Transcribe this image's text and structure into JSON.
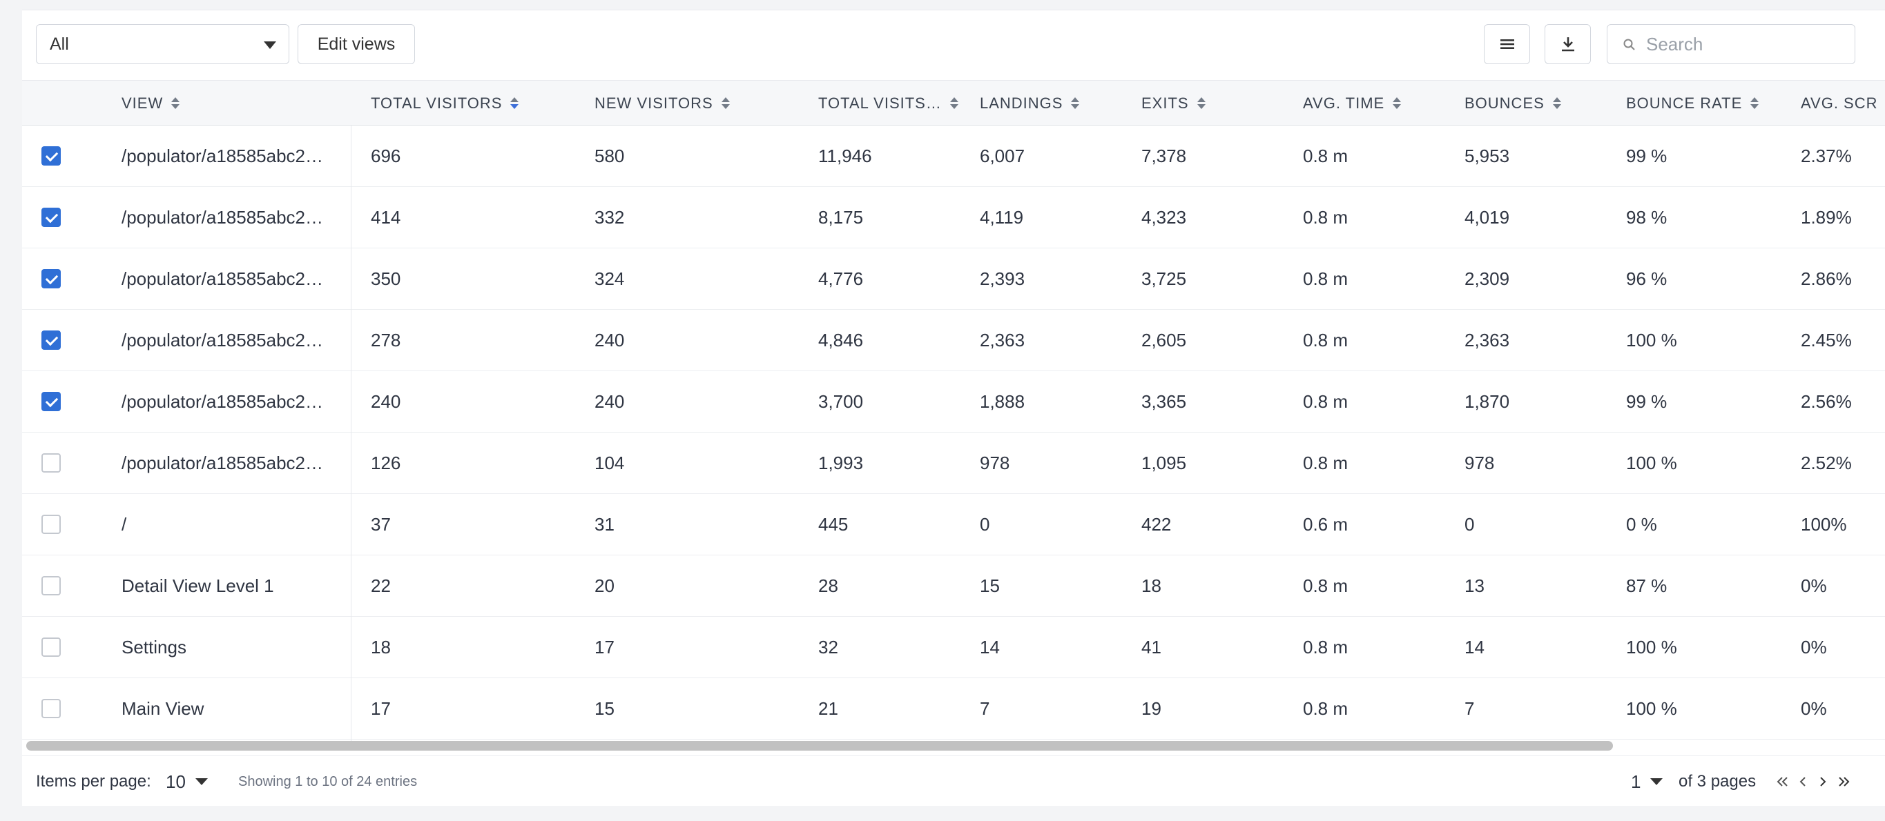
{
  "toolbar": {
    "filter_value": "All",
    "edit_views_label": "Edit views",
    "search_placeholder": "Search",
    "icons": [
      "menu-icon",
      "download-icon",
      "search-icon"
    ]
  },
  "columns": [
    {
      "label": "VIEW",
      "sort": "none"
    },
    {
      "label": "TOTAL VISITORS",
      "sort": "desc"
    },
    {
      "label": "NEW VISITORS",
      "sort": "none"
    },
    {
      "label": "TOTAL VISITS…",
      "sort": "none"
    },
    {
      "label": "LANDINGS",
      "sort": "none"
    },
    {
      "label": "EXITS",
      "sort": "none"
    },
    {
      "label": "AVG. TIME",
      "sort": "none"
    },
    {
      "label": "BOUNCES",
      "sort": "none"
    },
    {
      "label": "BOUNCE RATE",
      "sort": "none"
    },
    {
      "label": "AVG. SCR",
      "sort": "none"
    }
  ],
  "rows": [
    {
      "checked": true,
      "cells": [
        "/populator/a18585abc2…",
        "696",
        "580",
        "11,946",
        "6,007",
        "7,378",
        "0.8 m",
        "5,953",
        "99 %",
        "2.37%"
      ]
    },
    {
      "checked": true,
      "cells": [
        "/populator/a18585abc2…",
        "414",
        "332",
        "8,175",
        "4,119",
        "4,323",
        "0.8 m",
        "4,019",
        "98 %",
        "1.89%"
      ]
    },
    {
      "checked": true,
      "cells": [
        "/populator/a18585abc2…",
        "350",
        "324",
        "4,776",
        "2,393",
        "3,725",
        "0.8 m",
        "2,309",
        "96 %",
        "2.86%"
      ]
    },
    {
      "checked": true,
      "cells": [
        "/populator/a18585abc2…",
        "278",
        "240",
        "4,846",
        "2,363",
        "2,605",
        "0.8 m",
        "2,363",
        "100 %",
        "2.45%"
      ]
    },
    {
      "checked": true,
      "cells": [
        "/populator/a18585abc2…",
        "240",
        "240",
        "3,700",
        "1,888",
        "3,365",
        "0.8 m",
        "1,870",
        "99 %",
        "2.56%"
      ]
    },
    {
      "checked": false,
      "cells": [
        "/populator/a18585abc2…",
        "126",
        "104",
        "1,993",
        "978",
        "1,095",
        "0.8 m",
        "978",
        "100 %",
        "2.52%"
      ]
    },
    {
      "checked": false,
      "cells": [
        "/",
        "37",
        "31",
        "445",
        "0",
        "422",
        "0.6 m",
        "0",
        "0 %",
        "100%"
      ]
    },
    {
      "checked": false,
      "cells": [
        "Detail View Level 1",
        "22",
        "20",
        "28",
        "15",
        "18",
        "0.8 m",
        "13",
        "87 %",
        "0%"
      ]
    },
    {
      "checked": false,
      "cells": [
        "Settings",
        "18",
        "17",
        "32",
        "14",
        "41",
        "0.8 m",
        "14",
        "100 %",
        "0%"
      ]
    },
    {
      "checked": false,
      "cells": [
        "Main View",
        "17",
        "15",
        "21",
        "7",
        "19",
        "0.8 m",
        "7",
        "100 %",
        "0%"
      ]
    }
  ],
  "footer": {
    "items_per_page_label": "Items per page:",
    "items_per_page_value": "10",
    "showing_text": "Showing 1 to 10 of 24 entries",
    "current_page": "1",
    "of_pages_text": "of 3 pages",
    "pager_icons": [
      "first-page-icon",
      "prev-page-icon",
      "next-page-icon",
      "last-page-icon"
    ]
  }
}
